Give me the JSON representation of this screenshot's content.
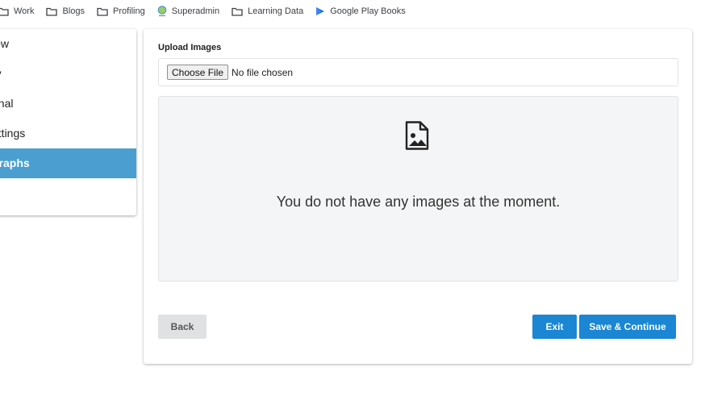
{
  "bookmarks": [
    {
      "label": "Work",
      "icon": "folder-icon"
    },
    {
      "label": "Blogs",
      "icon": "folder-icon"
    },
    {
      "label": "Profiling",
      "icon": "folder-icon"
    },
    {
      "label": "Superadmin",
      "icon": "globe-icon"
    },
    {
      "label": "Learning Data",
      "icon": "folder-icon"
    },
    {
      "label": "Google Play Books",
      "icon": "play-books-icon"
    }
  ],
  "sidebar": {
    "items": [
      {
        "label": "iew"
      },
      {
        "label": "ry"
      },
      {
        "label": "onal"
      },
      {
        "label": "ettings"
      },
      {
        "label": "graphs",
        "active": true
      }
    ]
  },
  "upload": {
    "label": "Upload Images",
    "choose_file": "Choose File",
    "file_status": "No file chosen"
  },
  "images": {
    "empty_message": "You do not have any images at the moment.",
    "icon": "image-icon"
  },
  "actions": {
    "back": "Back",
    "exit": "Exit",
    "save_continue": "Save & Continue"
  },
  "colors": {
    "accent": "#1a86d4",
    "sidebar_active": "#4a9fd0",
    "back_button": "#e0e1e2"
  }
}
